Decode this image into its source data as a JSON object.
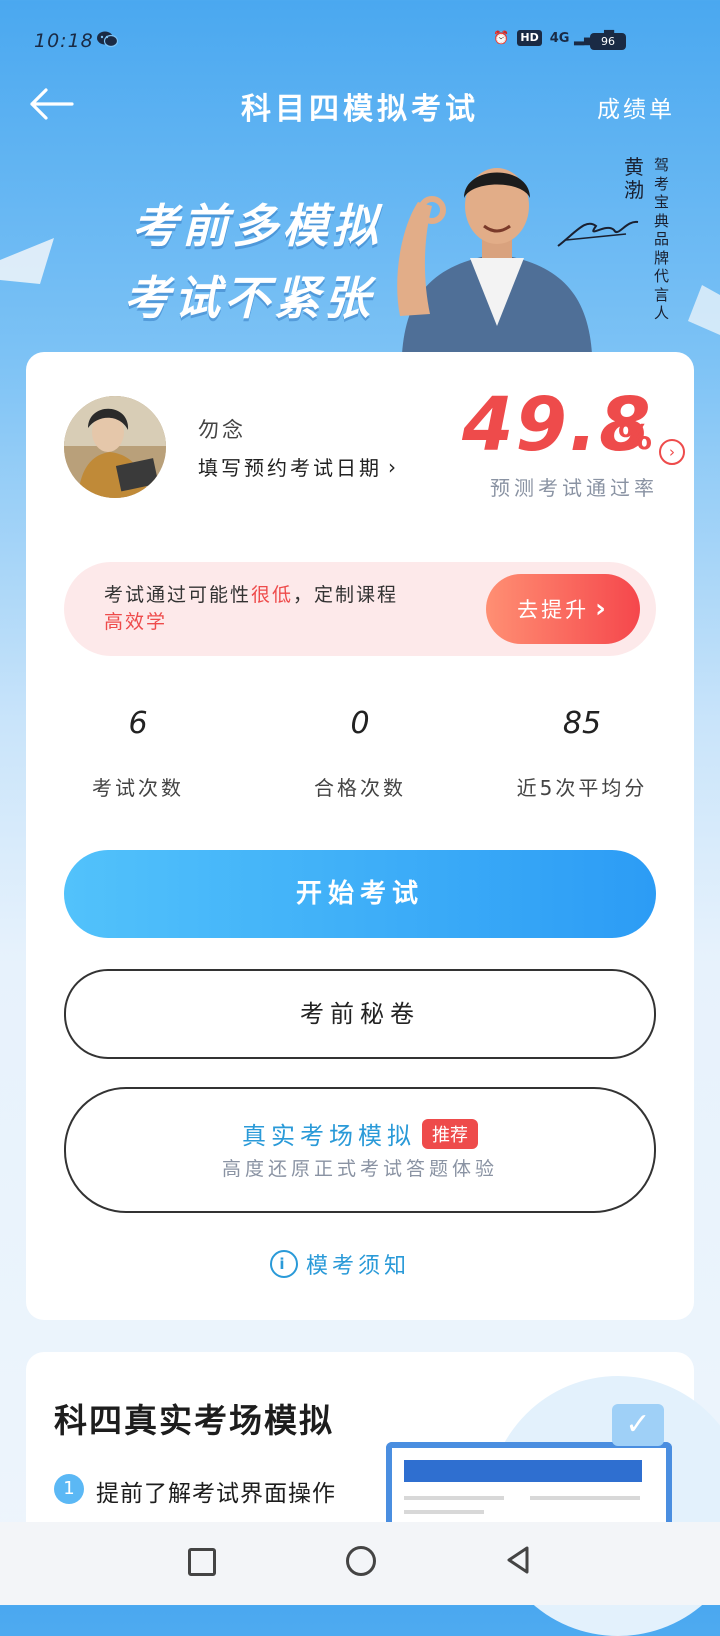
{
  "status": {
    "time": "10:18",
    "network": "4G",
    "hd": "HD",
    "battery": "96"
  },
  "header": {
    "title": "科目四模拟考试",
    "report_label": "成绩单"
  },
  "banner": {
    "slogan_line1": "考前多模拟",
    "slogan_line2": "考试不紧张",
    "celebrity_name": "黄渤",
    "celebrity_role": "驾考宝典品牌代言人"
  },
  "profile": {
    "username": "勿念",
    "exam_date_prompt": "填写预约考试日期"
  },
  "prediction": {
    "value": "49.8",
    "unit": "%",
    "label": "预测考试通过率"
  },
  "tip": {
    "prefix": "考试通过可能性",
    "highlight": "很低",
    "suffix": "，定制课程",
    "highlight2": "高效学",
    "button_label": "去提升"
  },
  "stats": [
    {
      "value": "6",
      "label": "考试次数"
    },
    {
      "value": "0",
      "label": "合格次数"
    },
    {
      "value": "85",
      "label": "近5次平均分"
    }
  ],
  "actions": {
    "start_exam": "开始考试",
    "secret_paper": "考前秘卷",
    "real_sim_title": "真实考场模拟",
    "real_sim_badge": "推荐",
    "real_sim_sub": "高度还原正式考试答题体验",
    "notice": "模考须知"
  },
  "section": {
    "title": "科四真实考场模拟",
    "step_number": "1",
    "step_text": "提前了解考试界面操作"
  },
  "colors": {
    "accent_blue": "#2c9cf5",
    "accent_red": "#ee4b4b"
  },
  "icons": [
    "back-arrow-icon",
    "wechat-icon",
    "alarm-icon",
    "signal-icon",
    "battery-icon",
    "chevron-right-icon",
    "info-icon",
    "nav-recent-icon",
    "nav-home-icon",
    "nav-back-icon"
  ]
}
